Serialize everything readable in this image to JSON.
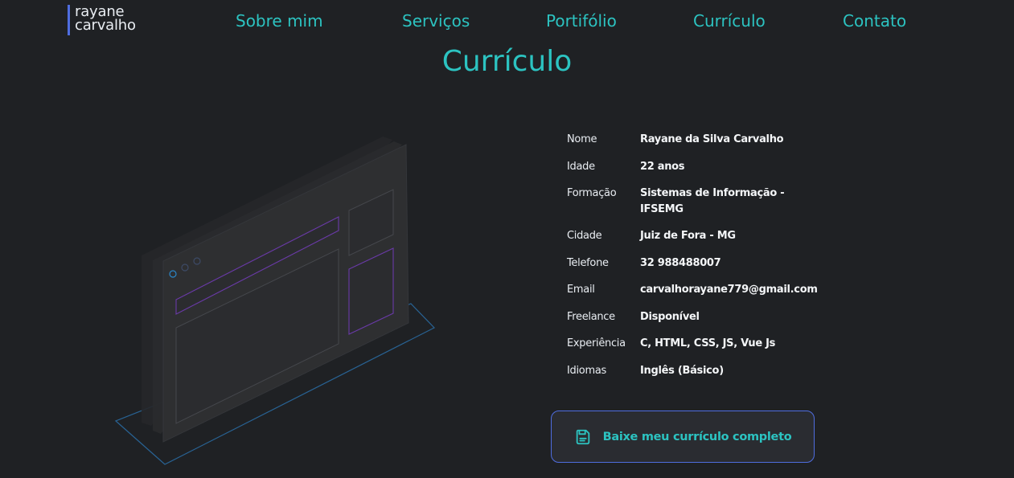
{
  "header": {
    "logo_line1": "rayane",
    "logo_line2": "carvalho",
    "nav": [
      {
        "label": "Sobre mim"
      },
      {
        "label": "Serviços"
      },
      {
        "label": "Portifólio"
      },
      {
        "label": "Currículo"
      },
      {
        "label": "Contato"
      }
    ]
  },
  "main": {
    "title": "Currículo",
    "illustration_icon": "browser-window-isometric-illustration",
    "info": [
      {
        "label": "Nome",
        "value": "Rayane da Silva Carvalho"
      },
      {
        "label": "Idade",
        "value": "22 anos"
      },
      {
        "label": "Formação",
        "value": "Sistemas de Informação - IFSEMG"
      },
      {
        "label": "Cidade",
        "value": "Juiz de Fora - MG"
      },
      {
        "label": "Telefone",
        "value": "32 988488007"
      },
      {
        "label": "Email",
        "value": "carvalhorayane779@gmail.com"
      },
      {
        "label": "Freelance",
        "value": "Disponível"
      },
      {
        "label": "Experiência",
        "value": "C, HTML, CSS, JS, Vue Js"
      },
      {
        "label": "Idiomas",
        "value": "Inglês (Básico)"
      }
    ],
    "download": {
      "label": "Baixe meu currículo completo",
      "icon": "save-icon"
    }
  },
  "colors": {
    "background": "#1f2124",
    "accent": "#2cc3c1",
    "border_blue": "#4f6de0",
    "text": "#e9edf2"
  }
}
